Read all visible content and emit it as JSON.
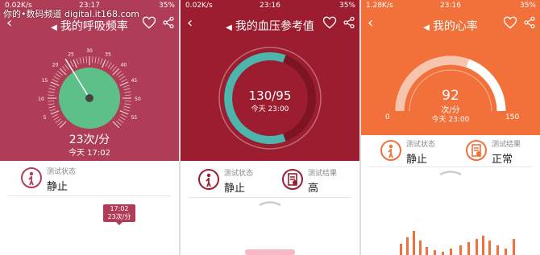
{
  "watermark": "你的•数码频道 digital.it168.com",
  "screens": [
    {
      "status": {
        "network": "0.02K/s",
        "time": "23:17",
        "battery": "35%"
      },
      "title": "我的呼吸频率",
      "value": "23次/分",
      "time_label": "今天 17:02",
      "gauge_ticks": [
        "0",
        "5",
        "10",
        "15",
        "20",
        "25",
        "30",
        "35",
        "40",
        "45",
        "50",
        "55",
        "60"
      ],
      "state_label": "测试状态",
      "state_value": "静止",
      "tooltip": {
        "time": "17:02",
        "value": "23次/分"
      },
      "colors": {
        "header": "#b03d57",
        "accent": "#5ec089"
      }
    },
    {
      "status": {
        "network": "0.02K/s",
        "time": "23:16",
        "battery": "35%"
      },
      "title": "我的血压参考值",
      "value": "130/95",
      "time_label": "今天 23:00",
      "state_label": "测试状态",
      "state_value": "静止",
      "result_label": "测试结果",
      "result_value": "高",
      "colors": {
        "header": "#9b1d2f",
        "accent": "#4db6ac"
      }
    },
    {
      "status": {
        "network": "1.28K/s",
        "time": "23:16",
        "battery": "35%"
      },
      "title": "我的心率",
      "value": "92",
      "unit": "次/分",
      "time_label": "今天 23:00",
      "scale_min": "0",
      "scale_max": "150",
      "heart_rate_fraction": 0.61,
      "state_label": "测试状态",
      "state_value": "静止",
      "result_label": "测试结果",
      "result_value": "正常",
      "colors": {
        "header": "#f2703a",
        "bars": "#f2703a"
      }
    }
  ]
}
